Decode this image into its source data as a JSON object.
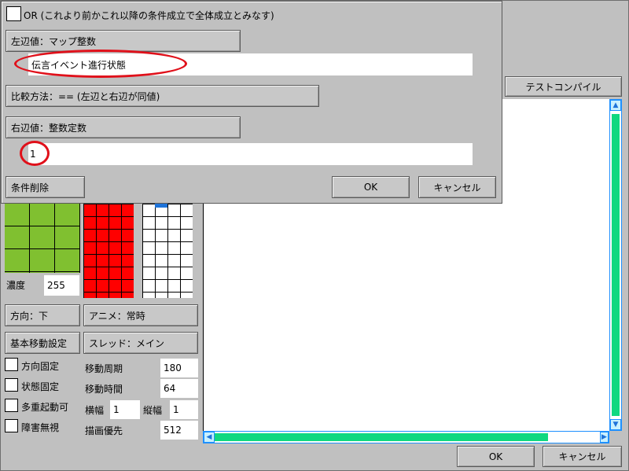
{
  "right_panel": {
    "test_compile_label": "テストコンパイル"
  },
  "footer": {
    "ok_label": "OK",
    "cancel_label": "キャンセル"
  },
  "left_panel": {
    "density_label": "濃度",
    "density_value": "255",
    "direction_button": "方向：下",
    "anime_button": "アニメ：常時",
    "basic_move_button": "基本移動設定",
    "thread_button": "スレッド：メイン",
    "check_direction_fixed": "方向固定",
    "check_state_fixed": "状態固定",
    "check_multi_start": "多重起動可",
    "check_ignore_obstacle": "障害無視",
    "move_period_label": "移動周期",
    "move_period_value": "180",
    "move_time_label": "移動時間",
    "move_time_value": "64",
    "width_label": "横幅",
    "width_value": "1",
    "height_label": "縦幅",
    "height_value": "1",
    "draw_priority_label": "描画優先",
    "draw_priority_value": "512"
  },
  "condition_dialog": {
    "or_label": "OR (これより前かこれ以降の条件成立で全体成立とみなす)",
    "left_value_button": "左辺値：マップ整数",
    "left_value_text": "伝言イベント進行状態",
    "compare_button": "比較方法：== (左辺と右辺が同値)",
    "right_value_button": "右辺値：整数定数",
    "right_value_text": "1",
    "delete_button": "条件削除",
    "ok_label": "OK",
    "cancel_label": "キャンセル"
  },
  "colors": {
    "highlight_ring": "#e0101a",
    "scroll_thumb": "#10d880",
    "scroll_border": "#1e90ff",
    "tile_green": "#80c030",
    "tile_red": "#ff0000"
  }
}
